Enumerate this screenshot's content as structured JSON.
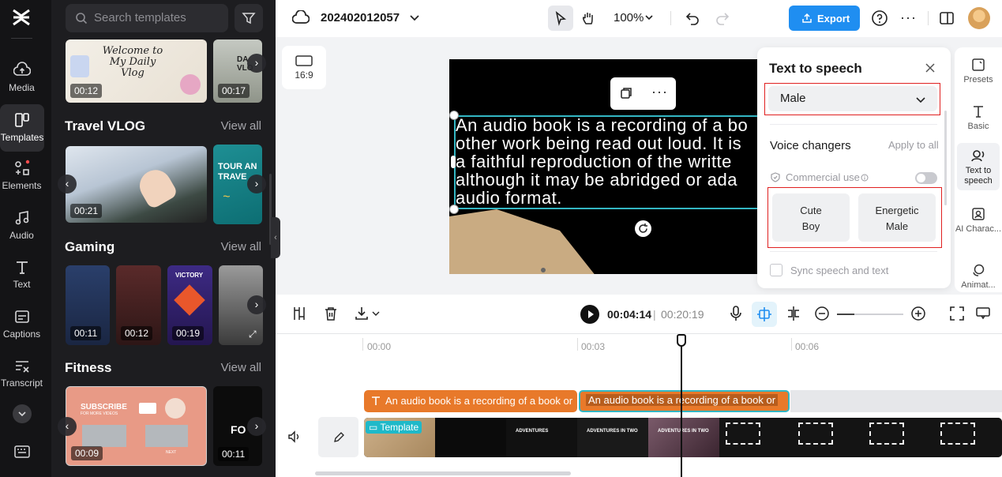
{
  "left_rail": {
    "items": [
      {
        "label": "Media",
        "icon": "media-icon"
      },
      {
        "label": "Templates",
        "icon": "templates-icon",
        "active": true
      },
      {
        "label": "Elements",
        "icon": "elements-icon"
      },
      {
        "label": "Audio",
        "icon": "audio-icon"
      },
      {
        "label": "Text",
        "icon": "text-icon"
      },
      {
        "label": "Captions",
        "icon": "captions-icon"
      },
      {
        "label": "Transcript",
        "icon": "transcript-icon"
      }
    ]
  },
  "templates_panel": {
    "search_placeholder": "Search templates",
    "top_row": [
      {
        "duration": "00:12",
        "text": "Welcome to My Daily Vlog"
      },
      {
        "duration": "00:17",
        "text": "DA VLO"
      }
    ],
    "sections": [
      {
        "title": "Travel VLOG",
        "view_all": "View all",
        "items": [
          {
            "duration": "00:21"
          },
          {
            "text": "TOUR AN TRAVE"
          }
        ]
      },
      {
        "title": "Gaming",
        "view_all": "View all",
        "items": [
          {
            "duration": "00:11"
          },
          {
            "duration": "00:12"
          },
          {
            "duration": "00:19",
            "text": "VICTORY"
          },
          {}
        ]
      },
      {
        "title": "Fitness",
        "view_all": "View all",
        "items": [
          {
            "duration": "00:09",
            "text": "SUBSCRIBE",
            "subtext": "FOR MORE VIDEOS",
            "tag": "NEXT"
          },
          {
            "duration": "00:11",
            "text": "FO"
          }
        ]
      }
    ]
  },
  "topbar": {
    "project_name": "202402012057",
    "zoom": "100%",
    "export_label": "Export"
  },
  "canvas": {
    "ratio_label": "16:9",
    "caption_lines": [
      "An audio book is a recording of a bo",
      "other work being read out loud. It is",
      " a faithful reproduction of the writte",
      "although it may be abridged or ada",
      "audio format."
    ]
  },
  "tts_panel": {
    "title": "Text to speech",
    "selected_voice": "Male",
    "voice_changers_title": "Voice changers",
    "apply_to_all": "Apply to all",
    "commercial_use": "Commercial use",
    "voices": [
      {
        "line1": "Cute",
        "line2": "Boy"
      },
      {
        "line1": "Energetic",
        "line2": "Male"
      }
    ],
    "sync_label": "Sync speech and text"
  },
  "right_rail": {
    "items": [
      {
        "label": "Presets",
        "icon": "presets-icon"
      },
      {
        "label": "Basic",
        "icon": "basic-text-icon"
      },
      {
        "label": "Text to speech",
        "icon": "text-to-speech-icon",
        "active": true
      },
      {
        "label": "AI Charac...",
        "icon": "ai-character-icon"
      },
      {
        "label": "Animat...",
        "icon": "animation-icon"
      }
    ]
  },
  "timeline": {
    "current_time": "00:04:14",
    "total_time": "00:20:19",
    "ruler": [
      "00:00",
      "00:03",
      "00:06"
    ],
    "text_clips": [
      "An audio book is a recording of a book or",
      "An audio book is a recording of a book or"
    ],
    "template_tag": "Template",
    "frame_texts": [
      "ADVENTURES",
      "ADVENTURES IN TWO",
      "ADVENTURES IN TWO"
    ]
  },
  "colors": {
    "accent": "#1f8ef1",
    "selection": "#33b6c3",
    "highlight_box": "#e02020",
    "text_clip": "#e8792a"
  }
}
